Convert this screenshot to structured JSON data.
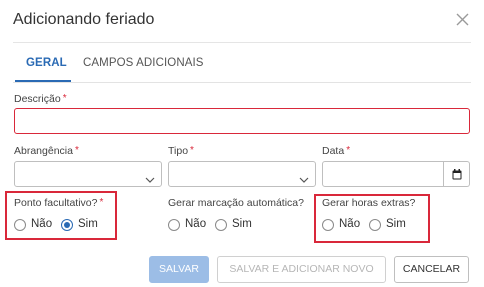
{
  "dialog": {
    "title": "Adicionando feriado",
    "close_icon": "close-icon"
  },
  "tabs": [
    {
      "label": "GERAL",
      "active": true
    },
    {
      "label": "CAMPOS ADICIONAIS",
      "active": false
    }
  ],
  "fields": {
    "descricao": {
      "label": "Descrição",
      "required": "*",
      "value": ""
    },
    "abrangencia": {
      "label": "Abrangência",
      "required": "*",
      "value": ""
    },
    "tipo": {
      "label": "Tipo",
      "required": "*",
      "value": ""
    },
    "data": {
      "label": "Data",
      "required": "*",
      "value": ""
    }
  },
  "radios": {
    "ponto_facultativo": {
      "label": "Ponto facultativo?",
      "required": "*",
      "options": [
        "Não",
        "Sim"
      ],
      "selected": "Sim"
    },
    "gerar_marcacao": {
      "label": "Gerar marcação automática?",
      "options": [
        "Não",
        "Sim"
      ],
      "selected": null
    },
    "gerar_horas_extras": {
      "label": "Gerar horas extras?",
      "options": [
        "Não",
        "Sim"
      ],
      "selected": null
    }
  },
  "buttons": {
    "save": "SALVAR",
    "save_add": "SALVAR E ADICIONAR NOVO",
    "cancel": "CANCELAR"
  },
  "colors": {
    "accent": "#2a6ab4",
    "error": "#d9283a",
    "primary_disabled": "#9cbde6"
  }
}
